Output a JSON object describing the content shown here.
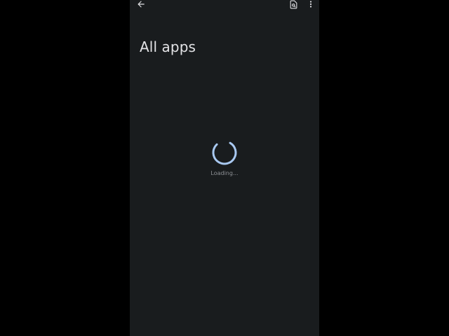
{
  "header": {
    "title": "All apps",
    "back_icon": "arrow-back-icon",
    "search_icon": "search-document-icon",
    "more_icon": "more-vert-icon"
  },
  "loading": {
    "text": "Loading...",
    "spinner_color": "#a8c8f0"
  },
  "colors": {
    "background": "#191c1e",
    "text": "#e3e3e6",
    "secondary_text": "#8e9196"
  }
}
